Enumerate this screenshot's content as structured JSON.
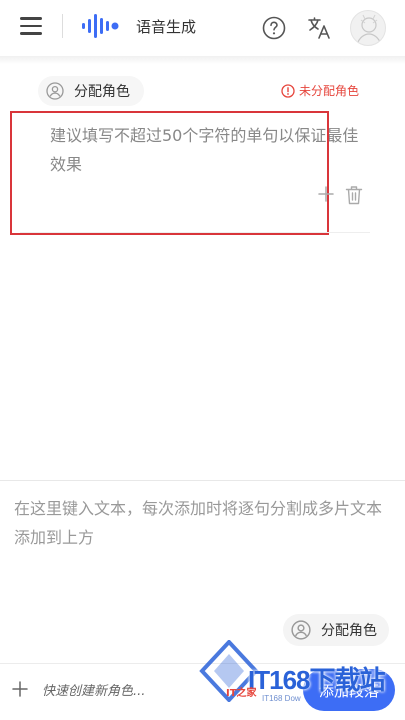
{
  "header": {
    "title": "语音生成",
    "icons": [
      "menu-icon",
      "voice-logo",
      "help-icon",
      "translate-icon",
      "avatar"
    ]
  },
  "sentence_card": {
    "role_chip_label": "分配角色",
    "unassigned_label": "未分配角色",
    "text": "建议填写不超过50个字符的单句以保证最佳效果",
    "highlight_color": "#d9353a",
    "warning_color": "#e6453c"
  },
  "input_area": {
    "placeholder": "在这里键入文本，每次添加时将逐句分割成多片文本添加到上方",
    "assign_role_label": "分配角色"
  },
  "bottom_bar": {
    "quick_create_label": "快速创建新角色...",
    "add_paragraph_label": "添加段落",
    "accent_color": "#3d6df5"
  },
  "watermark": {
    "brand": "IT168下载站",
    "sub": "IT168 Dow",
    "red_text": "IT之家"
  }
}
